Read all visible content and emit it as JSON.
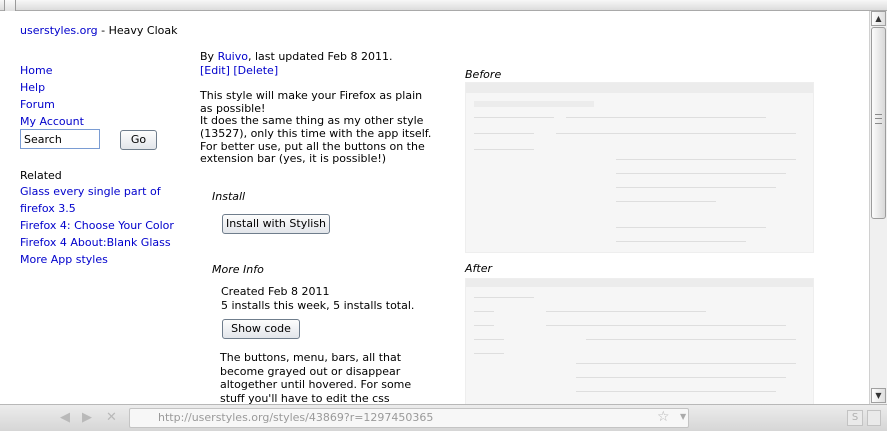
{
  "header": {
    "site": "userstyles.org",
    "separator": " - ",
    "style_name": "Heavy Cloak"
  },
  "nav": {
    "items": [
      "Home",
      "Help",
      "Forum",
      "My Account"
    ]
  },
  "search": {
    "placeholder": "Search",
    "value": "Search",
    "go_label": "Go"
  },
  "related": {
    "heading": "Related",
    "items": [
      "Glass every single part of firefox 3.5",
      "Firefox 4: Choose Your Color",
      "Firefox 4 About:Blank Glass",
      "More App styles"
    ]
  },
  "byline": {
    "by": "By ",
    "author": "Ruivo",
    "updated": ", last updated Feb 8 2011.",
    "edit": "[Edit]",
    "delete": "[Delete]"
  },
  "description": [
    "This style will make your Firefox as plain as possible!",
    "It does the same thing as my other style (13527), only this time with the app itself.",
    "For better use, put all the buttons on the extension bar (yes, it is possible!)"
  ],
  "install": {
    "heading": "Install",
    "button": "Install with Stylish"
  },
  "more_info": {
    "heading": "More Info",
    "created": "Created Feb 8 2011",
    "installs": "5 installs this week, 5 installs total.",
    "show_code": "Show code",
    "notes": "The buttons, menu, bars, all that become grayed out or disappear altogether until hovered. For some stuff you'll have to edit the css (comment/uncomment) in"
  },
  "screenshots": {
    "before": "Before",
    "after": "After"
  },
  "statusbar": {
    "url": "http://userstyles.org/styles/43869?r=1297450365"
  },
  "colors": {
    "link": "#0000cc",
    "chrome": "#dcdcdc"
  }
}
